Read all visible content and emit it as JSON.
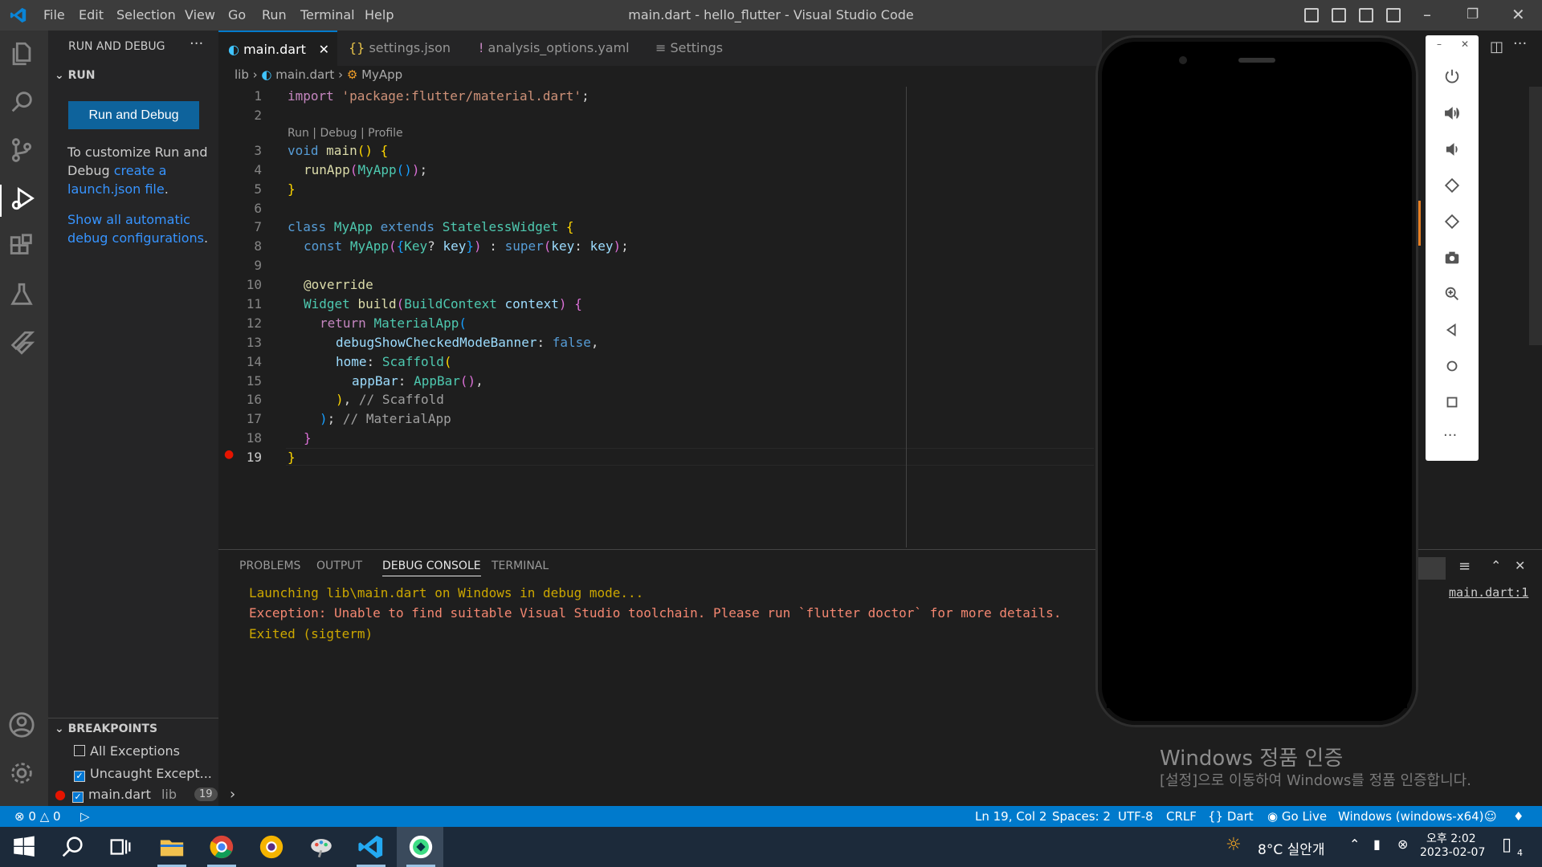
{
  "window": {
    "title": "main.dart - hello_flutter - Visual Studio Code"
  },
  "menu": [
    "File",
    "Edit",
    "Selection",
    "View",
    "Go",
    "Run",
    "Terminal",
    "Help"
  ],
  "sidebar": {
    "header": "RUN AND DEBUG",
    "section": "RUN",
    "run_button": "Run and Debug",
    "customize_text_1": "To customize Run and",
    "customize_text_2": "Debug ",
    "customize_link_1": "create a",
    "customize_link_2": "launch.json file",
    "customize_tail": ".",
    "show_link_1": "Show all automatic",
    "show_link_2": "debug configurations",
    "show_tail": ".",
    "breakpoints_header": "BREAKPOINTS",
    "breakpoints": [
      {
        "label": "All Exceptions",
        "checked": false
      },
      {
        "label": "Uncaught Except...",
        "checked": true
      },
      {
        "label": "main.dart",
        "dir": "lib",
        "line": "19",
        "checked": true
      }
    ]
  },
  "tabs": [
    {
      "label": "main.dart",
      "active": true
    },
    {
      "label": "settings.json",
      "active": false
    },
    {
      "label": "analysis_options.yaml",
      "active": false
    },
    {
      "label": "Settings",
      "active": false
    }
  ],
  "breadcrumb": {
    "folder": "lib",
    "file": "main.dart",
    "symbol": "MyApp"
  },
  "codelens": "Run | Debug | Profile",
  "line_numbers": [
    "1",
    "2",
    "3",
    "4",
    "5",
    "6",
    "7",
    "8",
    "9",
    "10",
    "11",
    "12",
    "13",
    "14",
    "15",
    "16",
    "17",
    "18",
    "19"
  ],
  "panel": {
    "tabs": [
      "PROBLEMS",
      "OUTPUT",
      "DEBUG CONSOLE",
      "TERMINAL"
    ],
    "active_tab": "DEBUG CONSOLE",
    "lines": [
      "Launching lib\\main.dart on Windows in debug mode...",
      "Exception: Unable to find suitable Visual Studio toolchain. Please run `flutter doctor` for more details.",
      "Exited (sigterm)"
    ],
    "source_link": "main.dart:1"
  },
  "status": {
    "errors": "0",
    "warnings": "0",
    "position": "Ln 19, Col 2",
    "spaces": "Spaces: 2",
    "encoding": "UTF-8",
    "eol": "CRLF",
    "language": "Dart",
    "golive": "Go Live",
    "device": "Windows (windows-x64)"
  },
  "watermark": {
    "line1": "Windows 정품 인증",
    "line2": "[설정]으로 이동하여 Windows를 정품 인증합니다."
  },
  "taskbar": {
    "weather": "8°C 실안개",
    "time": "오후 2:02",
    "date": "2023-02-07",
    "notifications": "4"
  },
  "colors": {
    "accent": "#007acc",
    "button": "#0e639c",
    "error": "#f48771"
  }
}
